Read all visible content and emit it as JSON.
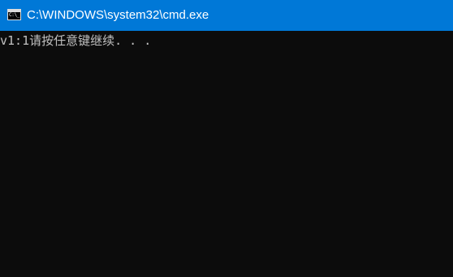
{
  "window": {
    "title": "C:\\WINDOWS\\system32\\cmd.exe",
    "app_icon": "console-window-icon",
    "app_icon_glyph": "C:\\_"
  },
  "console": {
    "lines": [
      "v1:1请按任意键继续. . ."
    ]
  },
  "colors": {
    "titlebar": "#0078d7",
    "title_text": "#ffffff",
    "console_bg": "#0c0c0c",
    "console_text": "#c0c0c0"
  }
}
